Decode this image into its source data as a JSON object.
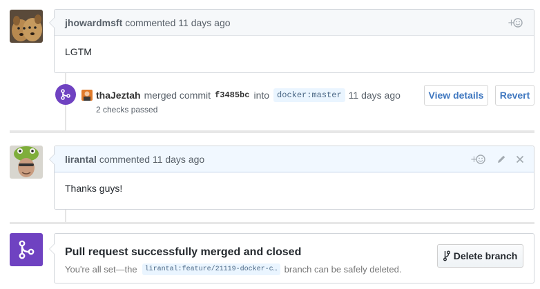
{
  "comment1": {
    "author": "jhowardmsft",
    "meta": "commented 11 days ago",
    "body": "LGTM"
  },
  "merge_event": {
    "author": "thaJeztah",
    "action": "merged commit",
    "commit": "f3485bc",
    "into": "into",
    "target_branch": "docker:master",
    "time": "11 days ago",
    "checks": "2 checks passed",
    "view_details_label": "View details",
    "revert_label": "Revert"
  },
  "comment2": {
    "author": "lirantal",
    "meta": "commented 11 days ago",
    "body": "Thanks guys!"
  },
  "merged_status": {
    "title": "Pull request successfully merged and closed",
    "desc_prefix": "You're all set—the",
    "branch": "lirantal:feature/21119-docker-c…",
    "desc_suffix": "branch can be safely deleted.",
    "delete_branch_label": "Delete branch"
  },
  "icons": {
    "reaction": "+☺",
    "merge": "git-merge-icon",
    "branch": "git-branch-icon",
    "edit": "pencil-icon",
    "close": "x-icon"
  },
  "colors": {
    "merge_purple": "#6f42c1",
    "link_blue": "#4078c0",
    "own_comment_header": "#f1f8ff"
  }
}
